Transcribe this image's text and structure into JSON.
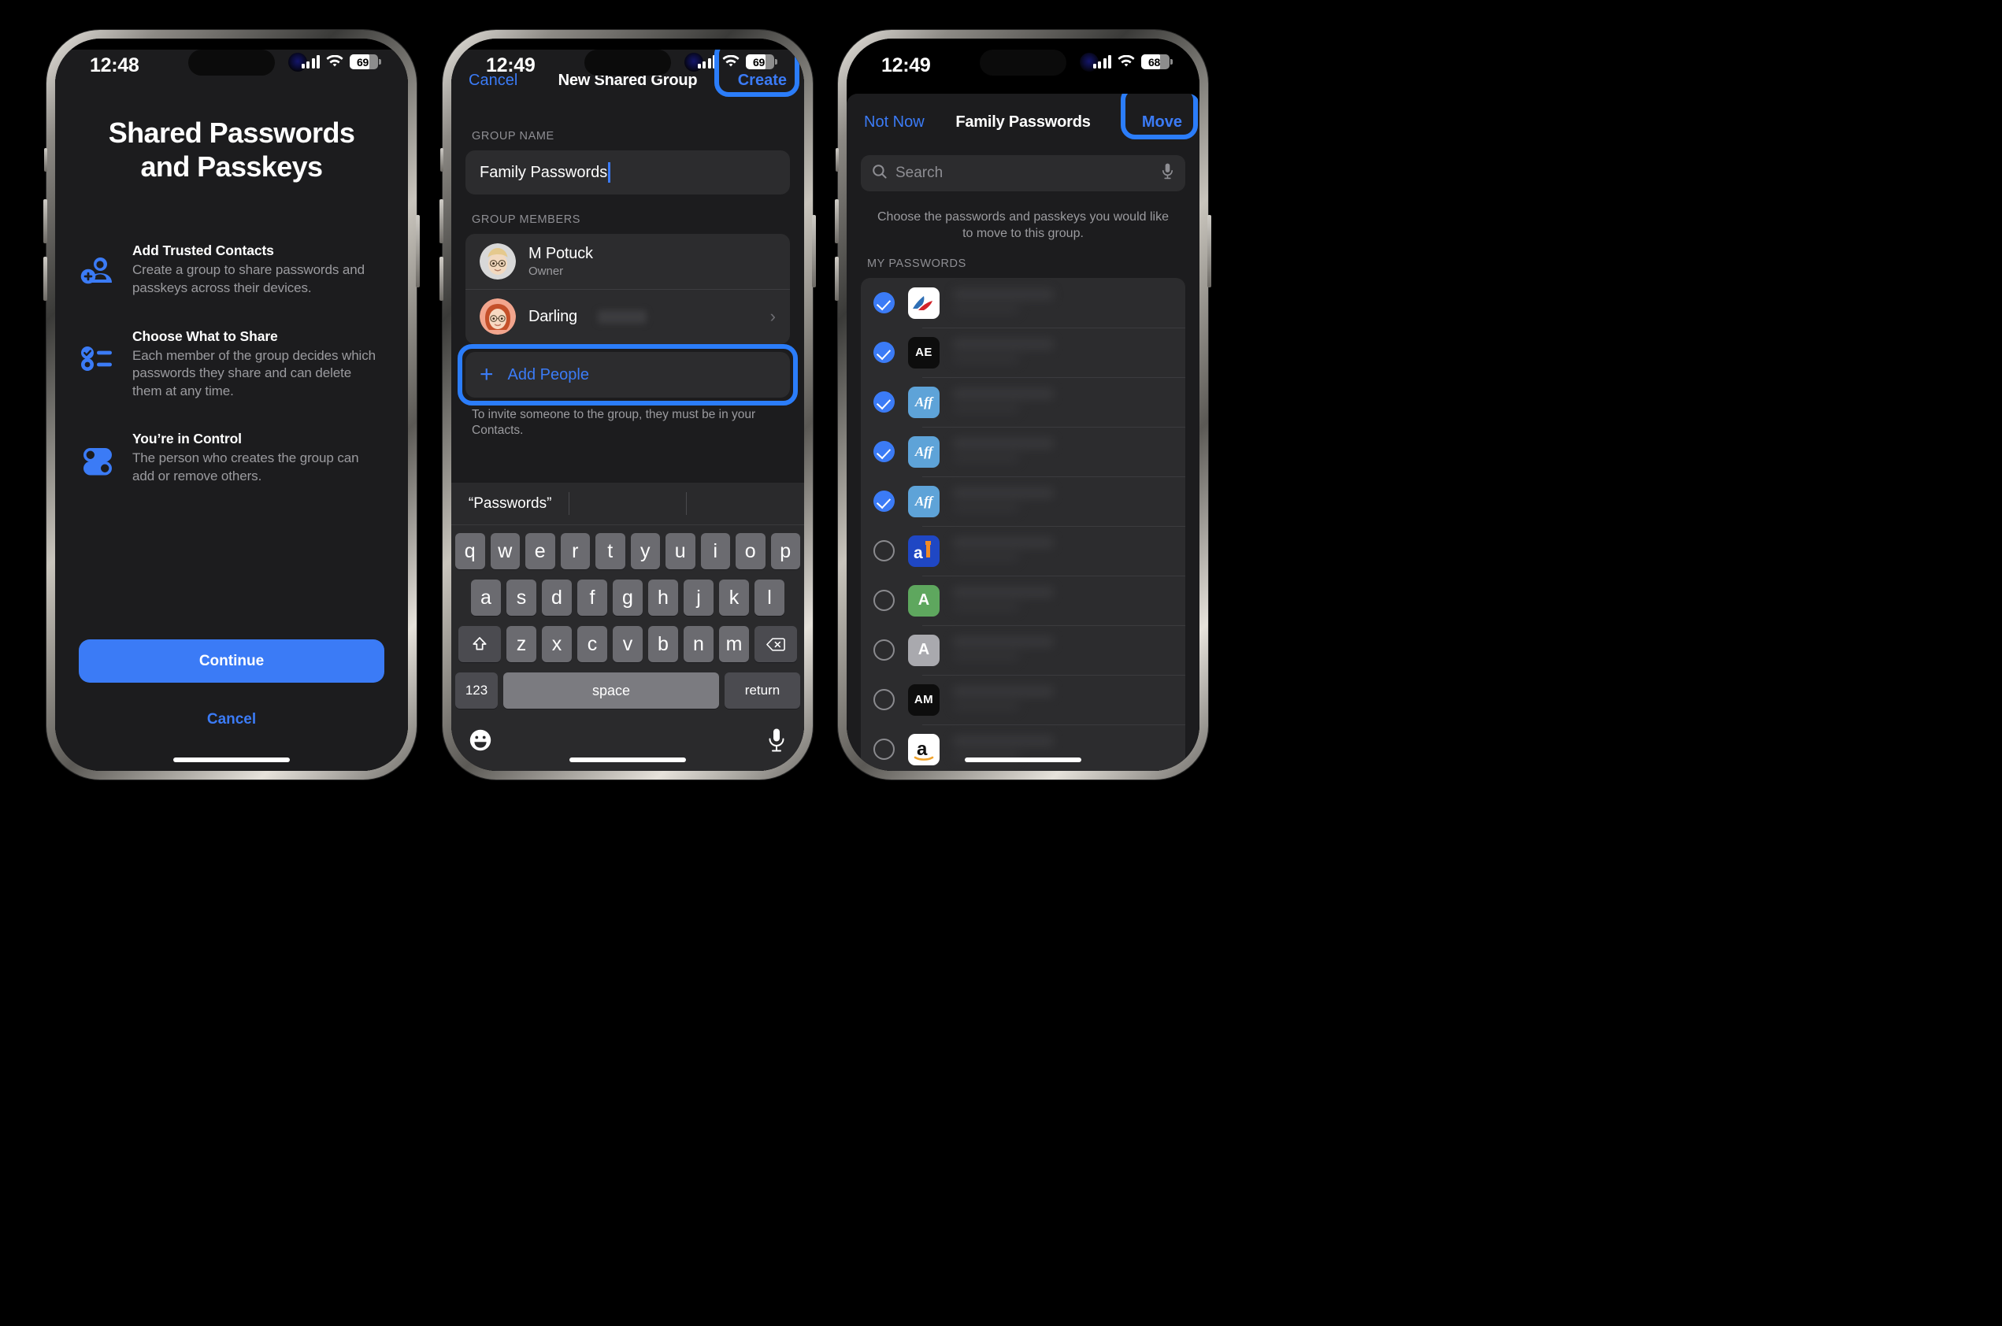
{
  "accent": "#3b7bf6",
  "highlight": "#2b7dfa",
  "phones": [
    {
      "status": {
        "time": "12:48",
        "battery": "69"
      },
      "onboarding": {
        "title_line1": "Shared Passwords",
        "title_line2": "and Passkeys",
        "features": [
          {
            "icon": "person-add-icon",
            "heading": "Add Trusted Contacts",
            "body": "Create a group to share passwords and passkeys across their devices."
          },
          {
            "icon": "checklist-icon",
            "heading": "Choose What to Share",
            "body": "Each member of the group decides which passwords they share and can delete them at any time."
          },
          {
            "icon": "toggles-icon",
            "heading": "You’re in Control",
            "body": "The person who creates the group can add or remove others."
          }
        ],
        "continue_label": "Continue",
        "cancel_label": "Cancel"
      }
    },
    {
      "status": {
        "time": "12:49",
        "battery": "69"
      },
      "group": {
        "nav": {
          "left": "Cancel",
          "title": "New Shared Group",
          "right": "Create"
        },
        "group_name_label": "GROUP NAME",
        "group_name_value": "Family Passwords",
        "group_members_label": "GROUP MEMBERS",
        "members": [
          {
            "name": "M Potuck",
            "sub": "Owner",
            "avatar": "memoji-blonde",
            "chevron": false,
            "redacted": false
          },
          {
            "name": "Darling",
            "sub": "",
            "avatar": "memoji-redhead",
            "chevron": true,
            "redacted": true
          }
        ],
        "add_people_label": "Add People",
        "footnote": "To invite someone to the group, they must be in your Contacts."
      },
      "keyboard": {
        "suggestion": "“Passwords”",
        "row1": [
          "q",
          "w",
          "e",
          "r",
          "t",
          "y",
          "u",
          "i",
          "o",
          "p"
        ],
        "row2": [
          "a",
          "s",
          "d",
          "f",
          "g",
          "h",
          "j",
          "k",
          "l"
        ],
        "row3": [
          "z",
          "x",
          "c",
          "v",
          "b",
          "n",
          "m"
        ],
        "shift_icon": "shift-icon",
        "backspace_icon": "backspace-icon",
        "numbers_key": "123",
        "space_key": "space",
        "return_key": "return",
        "emoji_icon": "emoji-icon",
        "dictation_icon": "microphone-icon"
      }
    },
    {
      "status": {
        "time": "12:49",
        "battery": "68"
      },
      "move": {
        "nav": {
          "left": "Not Now",
          "title": "Family Passwords",
          "right": "Move"
        },
        "search_placeholder": "Search",
        "hint": "Choose the passwords and passkeys you would like to move to this group.",
        "section_label": "MY PASSWORDS",
        "items": [
          {
            "checked": true,
            "icon": "american-airlines-icon",
            "icon_kind": "aa",
            "icon_bg": "#ffffff",
            "icon_fg": "#d2232a",
            "icon_text": ""
          },
          {
            "checked": true,
            "icon": "ae-icon",
            "icon_kind": "text",
            "icon_bg": "#0d0d0d",
            "icon_fg": "#ffffff",
            "icon_text": "AE"
          },
          {
            "checked": true,
            "icon": "aff-icon",
            "icon_kind": "script",
            "icon_bg": "#5ea3d8",
            "icon_fg": "#ffffff",
            "icon_text": "Aff"
          },
          {
            "checked": true,
            "icon": "aff-icon",
            "icon_kind": "script",
            "icon_bg": "#5ea3d8",
            "icon_fg": "#ffffff",
            "icon_text": "Aff"
          },
          {
            "checked": true,
            "icon": "aff-icon",
            "icon_kind": "script",
            "icon_bg": "#5ea3d8",
            "icon_fg": "#ffffff",
            "icon_text": "Aff"
          },
          {
            "checked": false,
            "icon": "ai-icon",
            "icon_kind": "ai",
            "icon_bg": "#1f47c4",
            "icon_fg": "#ffffff",
            "icon_text": "a"
          },
          {
            "checked": false,
            "icon": "a-green-icon",
            "icon_kind": "text",
            "icon_bg": "#5ea75e",
            "icon_fg": "#ffffff",
            "icon_text": "A"
          },
          {
            "checked": false,
            "icon": "a-gray-icon",
            "icon_kind": "text",
            "icon_bg": "#a9a9ae",
            "icon_fg": "#ffffff",
            "icon_text": "A"
          },
          {
            "checked": false,
            "icon": "am-icon",
            "icon_kind": "text",
            "icon_bg": "#0d0d0d",
            "icon_fg": "#ffffff",
            "icon_text": "AM"
          },
          {
            "checked": false,
            "icon": "amazon-icon",
            "icon_kind": "amazon",
            "icon_bg": "#ffffff",
            "icon_fg": "#111111",
            "icon_text": "a"
          }
        ]
      }
    }
  ]
}
